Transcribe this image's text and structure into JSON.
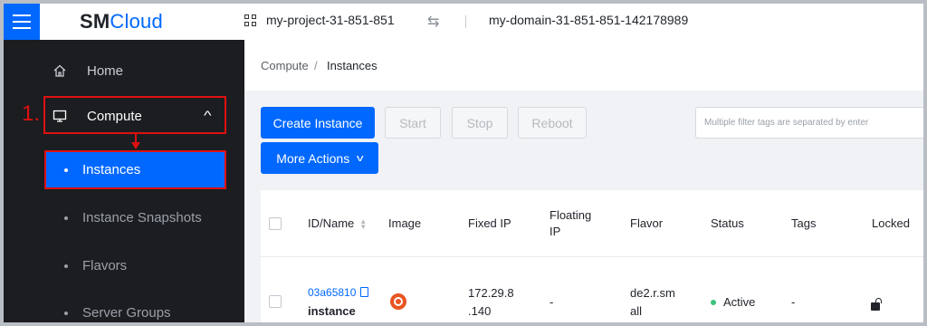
{
  "app": {
    "logo_sm": "SM",
    "logo_cloud": "Cloud"
  },
  "header": {
    "project": "my-project-31-851-851",
    "swap_glyph": "⇆",
    "domain": "my-domain-31-851-851-142178989"
  },
  "sidebar": {
    "home": "Home",
    "compute": "Compute",
    "sub_items": [
      "Instances",
      "Instance Snapshots",
      "Flavors",
      "Server Groups"
    ]
  },
  "annotation": {
    "step": "1."
  },
  "breadcrumb": {
    "parent": "Compute",
    "separator": "/",
    "current": "Instances"
  },
  "toolbar": {
    "create": "Create Instance",
    "start": "Start",
    "stop": "Stop",
    "reboot": "Reboot",
    "more": "More Actions",
    "filter_placeholder": "Multiple filter tags are separated by enter"
  },
  "table": {
    "headers": {
      "id_name": "ID/Name",
      "image": "Image",
      "fixed_ip": "Fixed IP",
      "floating_ip_1": "Floating",
      "floating_ip_2": "IP",
      "flavor": "Flavor",
      "status": "Status",
      "tags": "Tags",
      "locked": "Locked"
    },
    "rows": [
      {
        "id": "03a65810",
        "name": "instance",
        "image_icon": "ubuntu-icon",
        "fixed_ip_1": "172.29.8",
        "fixed_ip_2": ".140",
        "floating_ip": "-",
        "flavor_1": "de2.r.sm",
        "flavor_2": "all",
        "status": "Active",
        "tags": "-",
        "locked_icon": "unlock-icon"
      }
    ]
  },
  "colors": {
    "primary": "#0068ff",
    "sidebar_bg": "#1b1d21",
    "annotation": "#e01010",
    "active_status": "#3bc27b"
  }
}
